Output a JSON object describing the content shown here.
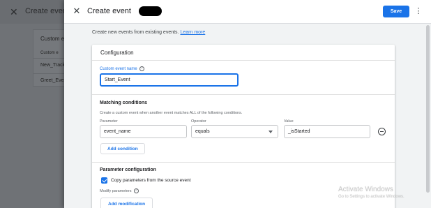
{
  "background": {
    "title": "Create events",
    "card_title": "Custom e",
    "card_column": "Custom e",
    "rows": [
      "New_Tracki",
      "Greet_Event"
    ]
  },
  "drawer": {
    "title": "Create event",
    "save_label": "Save",
    "intro_text": "Create new events from existing events.",
    "learn_more": "Learn more"
  },
  "configuration": {
    "card_title": "Configuration",
    "custom_event_name_label": "Custom event name",
    "custom_event_name_value": "Start_Event"
  },
  "matching_conditions": {
    "title": "Matching conditions",
    "description": "Create a custom event when another event matches ALL of the following conditions.",
    "columns": {
      "parameter": "Parameter",
      "operator": "Operator",
      "value": "Value"
    },
    "condition": {
      "parameter": "event_name",
      "operator": "equals",
      "value": "_isStarted"
    },
    "add_condition_label": "Add condition"
  },
  "parameter_configuration": {
    "title": "Parameter configuration",
    "copy_params_label": "Copy parameters from the source event",
    "copy_params_checked": true,
    "modify_params_label": "Modify parameters",
    "add_modification_label": "Add modification"
  },
  "watermark": {
    "title": "Activate Windows",
    "subtitle": "Go to Settings to activate Windows."
  },
  "colors": {
    "accent": "#1a73e8",
    "drawer_bg": "#f1f3f4",
    "card_bg": "#ffffff"
  }
}
